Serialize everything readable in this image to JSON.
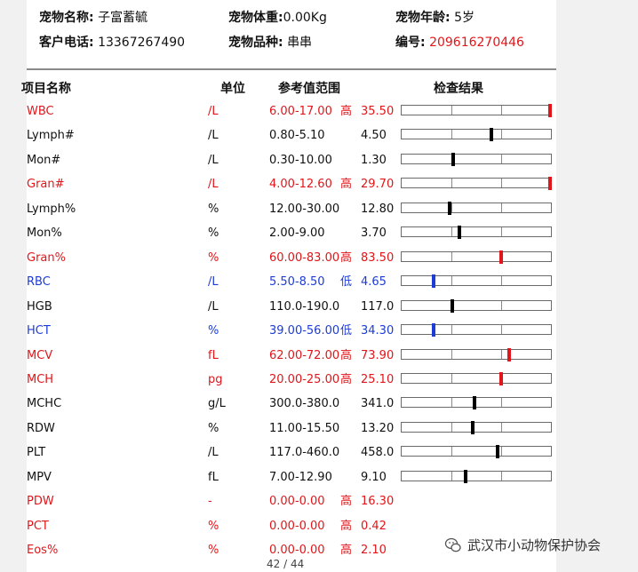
{
  "header": {
    "name_label": "宠物名称:",
    "name_value": "子富蓄毓",
    "weight_label": "宠物体重:",
    "weight_value": "0.00Kg",
    "age_label": "宠物年龄:",
    "age_value": "5岁",
    "phone_label": "客户电话:",
    "phone_value": "13367267490",
    "breed_label": "宠物品种:",
    "breed_value": "串串",
    "id_label": "编号:",
    "id_value": "209616270446"
  },
  "columns": {
    "item": "项目名称",
    "unit": "单位",
    "range": "参考值范围",
    "result": "检查结果"
  },
  "colors": {
    "high": "#e0161a",
    "low": "#1d3cd6",
    "normal": "#000000"
  },
  "rows": [
    {
      "name": "WBC",
      "unit": "/L",
      "range": "6.00-17.00",
      "flag": "高",
      "value": "35.50",
      "status": "high",
      "level": 0.995
    },
    {
      "name": "Lymph#",
      "unit": "/L",
      "range": "0.80-5.10",
      "flag": "",
      "value": "4.50",
      "status": "normal",
      "level": 0.6
    },
    {
      "name": "Mon#",
      "unit": "/L",
      "range": "0.30-10.00",
      "flag": "",
      "value": "1.30",
      "status": "normal",
      "level": 0.345
    },
    {
      "name": "Gran#",
      "unit": "/L",
      "range": "4.00-12.60",
      "flag": "高",
      "value": "29.70",
      "status": "high",
      "level": 0.995
    },
    {
      "name": "Lymph%",
      "unit": "%",
      "range": "12.00-30.00",
      "flag": "",
      "value": "12.80",
      "status": "normal",
      "level": 0.32
    },
    {
      "name": "Mon%",
      "unit": "%",
      "range": "2.00-9.00",
      "flag": "",
      "value": "3.70",
      "status": "normal",
      "level": 0.385
    },
    {
      "name": "Gran%",
      "unit": "%",
      "range": "60.00-83.00",
      "flag": "高",
      "value": "83.50",
      "status": "high",
      "level": 0.665
    },
    {
      "name": "RBC",
      "unit": "/L",
      "range": "5.50-8.50",
      "flag": "低",
      "value": "4.65",
      "status": "low",
      "level": 0.215
    },
    {
      "name": "HGB",
      "unit": "/L",
      "range": "110.0-190.0",
      "flag": "",
      "value": "117.0",
      "status": "normal",
      "level": 0.34
    },
    {
      "name": "HCT",
      "unit": "%",
      "range": "39.00-56.00",
      "flag": "低",
      "value": "34.30",
      "status": "low",
      "level": 0.215
    },
    {
      "name": "MCV",
      "unit": "fL",
      "range": "62.00-72.00",
      "flag": "高",
      "value": "73.90",
      "status": "high",
      "level": 0.72
    },
    {
      "name": "MCH",
      "unit": "pg",
      "range": "20.00-25.00",
      "flag": "高",
      "value": "25.10",
      "status": "high",
      "level": 0.665
    },
    {
      "name": "MCHC",
      "unit": "g/L",
      "range": "300.0-380.0",
      "flag": "",
      "value": "341.0",
      "status": "normal",
      "level": 0.49
    },
    {
      "name": "RDW",
      "unit": "%",
      "range": "11.00-15.50",
      "flag": "",
      "value": "13.20",
      "status": "normal",
      "level": 0.475
    },
    {
      "name": "PLT",
      "unit": "/L",
      "range": "117.0-460.0",
      "flag": "",
      "value": "458.0",
      "status": "normal",
      "level": 0.645
    },
    {
      "name": "MPV",
      "unit": "fL",
      "range": "7.00-12.90",
      "flag": "",
      "value": "9.10",
      "status": "normal",
      "level": 0.43
    },
    {
      "name": "PDW",
      "unit": "-",
      "range": "0.00-0.00",
      "flag": "高",
      "value": "16.30",
      "status": "high",
      "level": null
    },
    {
      "name": "PCT",
      "unit": "%",
      "range": "0.00-0.00",
      "flag": "高",
      "value": "0.42",
      "status": "high",
      "level": null
    },
    {
      "name": "Eos%",
      "unit": "%",
      "range": "0.00-0.00",
      "flag": "高",
      "value": "2.10",
      "status": "high",
      "level": null
    }
  ],
  "pager": "42 / 44",
  "watermark": {
    "text": "武汉市小动物保护协会",
    "icon": "wechat-icon"
  }
}
